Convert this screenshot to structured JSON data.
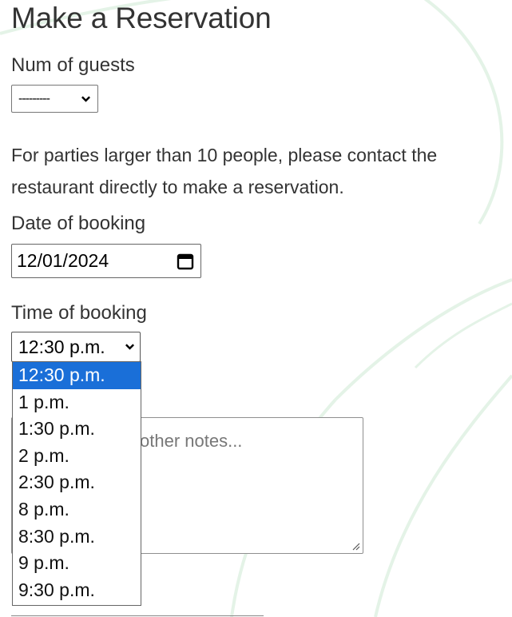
{
  "page": {
    "title": "Make a Reservation"
  },
  "guests": {
    "label": "Num of guests",
    "selected": "---------"
  },
  "info_text": "For parties larger than 10 people, please contact the restaurant directly to make a reservation.",
  "date": {
    "label": "Date of booking",
    "value": "12/01/2024",
    "icon": "calendar-icon"
  },
  "time": {
    "label": "Time of booking",
    "selected": "12:30 p.m.",
    "options": [
      "12:30 p.m.",
      "1 p.m.",
      "1:30 p.m.",
      "2 p.m.",
      "2:30 p.m.",
      "8 p.m.",
      "8:30 p.m.",
      "9 p.m.",
      "9:30 p.m."
    ],
    "selected_index": 0
  },
  "notes": {
    "placeholder_visible": "other notes..."
  },
  "colors": {
    "text": "#333333",
    "highlight": "#1a6fd8",
    "decoration": "#e3f2e6"
  }
}
